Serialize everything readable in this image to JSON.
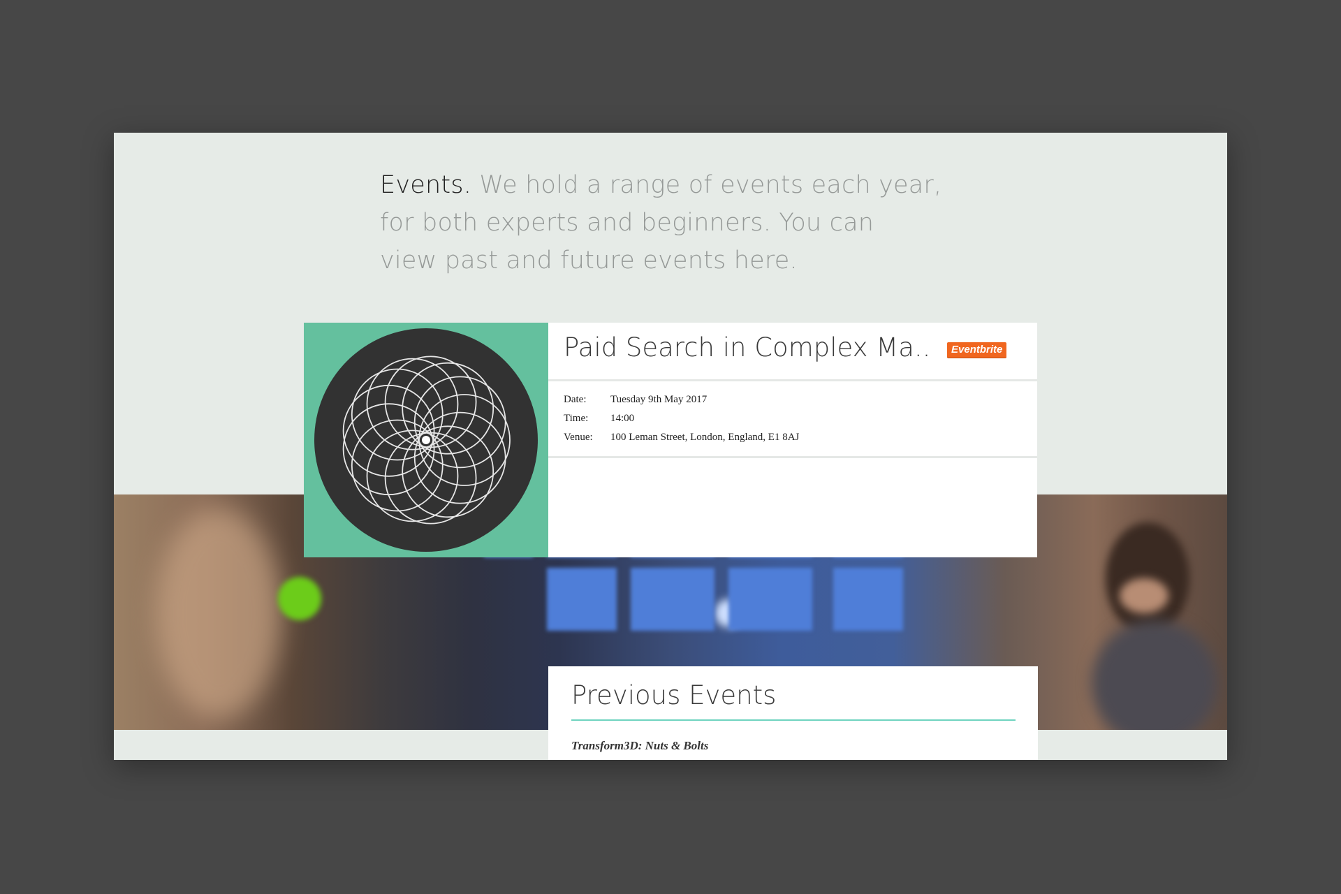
{
  "intro": {
    "lead": "Events.",
    "line1_rest": "We hold a range of events each year,",
    "line2": "for both experts and beginners.  You can",
    "line3": "view past and future events here."
  },
  "event": {
    "title": "Paid Search in Complex Ma..",
    "badge": "Eventbrite",
    "date_label": "Date:",
    "date_value": "Tuesday 9th May 2017",
    "time_label": "Time:",
    "time_value": "14:00",
    "venue_label": "Venue:",
    "venue_value": "100 Leman Street, London, England, E1 8AJ"
  },
  "previous": {
    "title": "Previous Events",
    "items": [
      "Transform3D: Nuts & Bolts"
    ]
  },
  "colors": {
    "page_bg": "#e6ebe7",
    "thumb_bg": "#64c09e",
    "badge": "#f0661f",
    "accent_rule": "#6fd4c0"
  }
}
